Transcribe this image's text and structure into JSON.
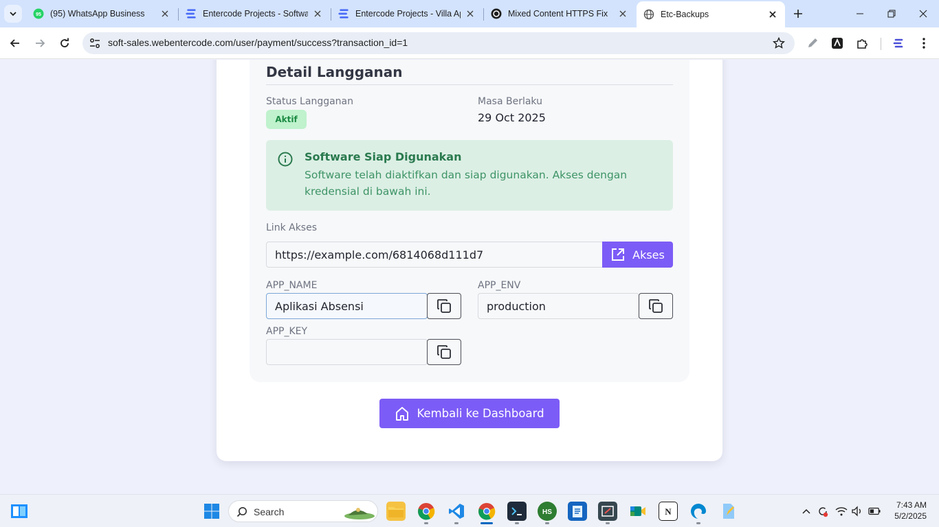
{
  "browser": {
    "tabs": [
      {
        "title": "(95) WhatsApp Business",
        "icon": "whatsapp-icon",
        "badge": "95"
      },
      {
        "title": "Entercode Projects - Software",
        "icon": "entercode-icon"
      },
      {
        "title": "Entercode Projects - Villa App",
        "icon": "entercode-icon"
      },
      {
        "title": "Mixed Content HTTPS Fix",
        "icon": "openai-icon"
      },
      {
        "title": "Etc-Backups",
        "icon": "globe-icon"
      }
    ],
    "url": "soft-sales.webentercode.com/user/payment/success?transaction_id=1"
  },
  "page": {
    "detail_title": "Detail Langganan",
    "status_label": "Status Langganan",
    "status_value": "Aktif",
    "expiry_label": "Masa Berlaku",
    "expiry_value": "29 Oct 2025",
    "alert": {
      "title": "Software Siap Digunakan",
      "body": "Software telah diaktifkan dan siap digunakan. Akses dengan kredensial di bawah ini."
    },
    "link_label": "Link Akses",
    "link_value": "https://example.com/6814068d111d7",
    "akses_button": "Akses",
    "app_name_label": "APP_NAME",
    "app_name_value": "Aplikasi Absensi",
    "app_env_label": "APP_ENV",
    "app_env_value": "production",
    "app_key_label": "APP_KEY",
    "app_key_value": "",
    "dashboard_button": "Kembali ke Dashboard"
  },
  "taskbar": {
    "search_placeholder": "Search",
    "time": "7:43 AM",
    "date": "5/2/2025"
  },
  "colors": {
    "accent": "#7c5cf6",
    "success_bg": "#dcefe5",
    "success_text": "#2a7a4e",
    "badge_bg": "#bff2cd",
    "badge_text": "#1c8a43"
  }
}
